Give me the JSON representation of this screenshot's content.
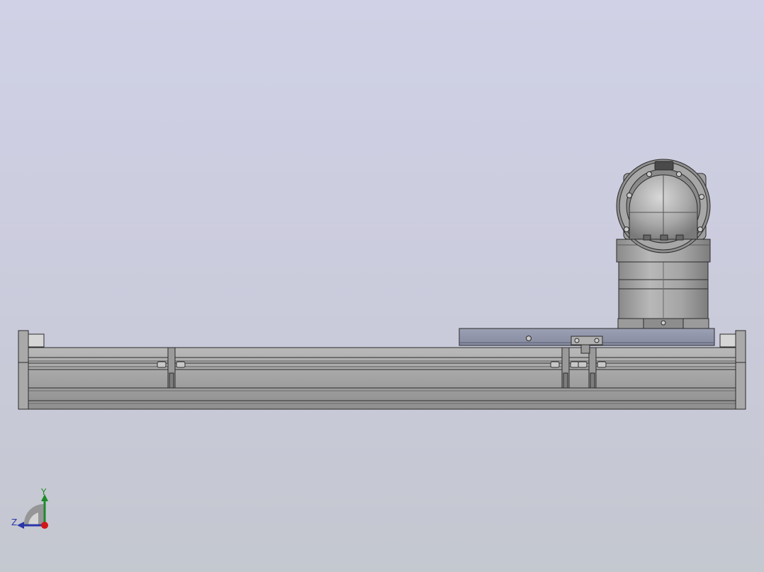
{
  "viewport": {
    "background_top": "#d0d1e6",
    "background_bottom": "#c4c8cf",
    "model_description_icon": "linear-actuator-with-motor"
  },
  "triad": {
    "y_label": "Y",
    "z_label": "Z",
    "x_color": "#d01818",
    "y_color": "#1f8a2a",
    "z_color": "#2a35a8"
  }
}
